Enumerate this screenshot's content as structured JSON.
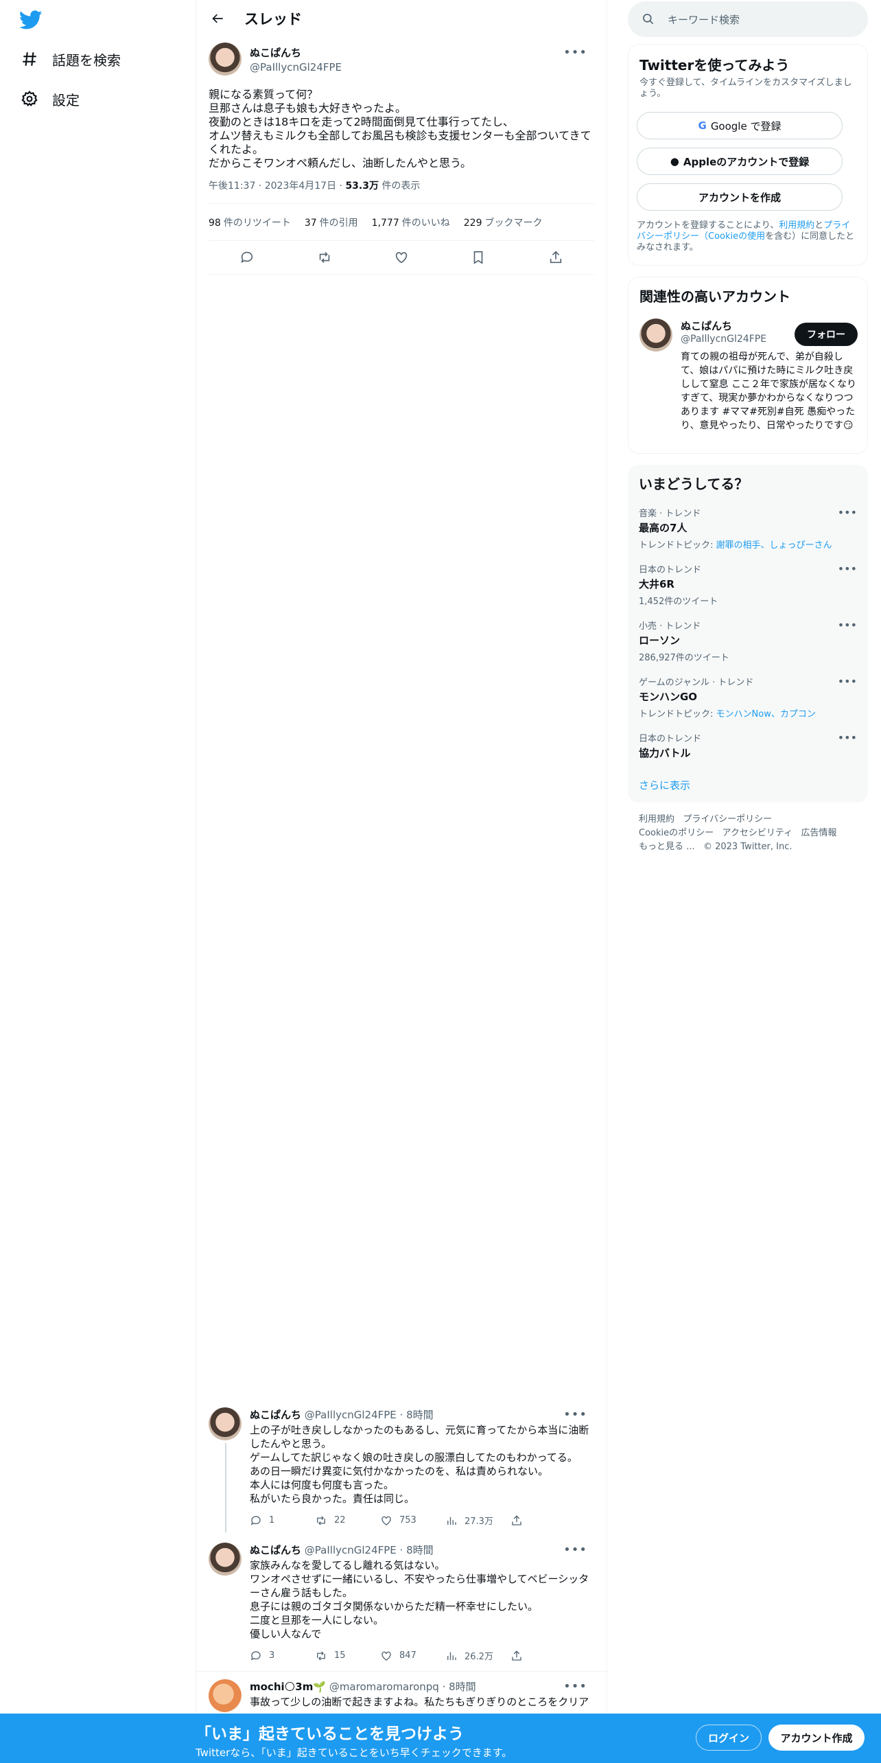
{
  "nav": {
    "explore_label": "話題を検索",
    "settings_label": "設定"
  },
  "header": {
    "title": "スレッド"
  },
  "main_tweet": {
    "display_name": "ぬこぱんち",
    "handle": "@PaIllycnGl24FPE",
    "text": "親になる素質って何？\n旦那さんは息子も娘も大好きやったよ。\n夜勤のときは18キロを走って2時間面倒見て仕事行ってたし、\nオムツ替えもミルクも全部してお風呂も検診も支援センターも全部ついてきてくれたよ。\nだからこそワンオペ頼んだし、油断したんやと思う。",
    "time": "午後11:37",
    "date": "2023年4月17日",
    "views_count": "53.3万",
    "views_label": "件の表示",
    "retweets_count": "98",
    "retweets_label": "件のリツイート",
    "quotes_count": "37",
    "quotes_label": "件の引用",
    "likes_count": "1,777",
    "likes_label": "件のいいね",
    "bookmarks_count": "229",
    "bookmarks_label": "ブックマーク"
  },
  "replies": [
    {
      "display_name": "ぬこぱんち",
      "handle": "@PaIllycnGl24FPE",
      "time": "8時間",
      "text": "上の子が吐き戻ししなかったのもあるし、元気に育ってたから本当に油断したんやと思う。\nゲームしてた訳じゃなく娘の吐き戻しの服漂白してたのもわかってる。\nあの日一瞬だけ異変に気付かなかったのを、私は責められない。\n本人には何度も何度も言った。\n私がいたら良かった。責任は同じ。",
      "replies": "1",
      "retweets": "22",
      "likes": "753",
      "views": "27.3万"
    },
    {
      "display_name": "ぬこぱんち",
      "handle": "@PaIllycnGl24FPE",
      "time": "8時間",
      "text": "家族みんなを愛してるし離れる気はない。\nワンオペさせずに一緒にいるし、不安やったら仕事増やしてベビーシッターさん雇う話もした。\n息子には親のゴタゴタ関係ないからただ精一杯幸せにしたい。\n二度と旦那を一人にしない。\n優しい人なんで",
      "replies": "3",
      "retweets": "15",
      "likes": "847",
      "views": "26.2万"
    },
    {
      "display_name": "mochi🌕3m🌱",
      "handle": "@maromaromaronpq",
      "time": "8時間",
      "text": "事故って少しの油断で起きますよね。私たちもぎりぎりのところをクリア"
    }
  ],
  "right": {
    "search_placeholder": "キーワード検索",
    "signup_card": {
      "title": "Twitterを使ってみよう",
      "subtitle": "今すぐ登録して、タイムラインをカスタマイズしましょう。",
      "google_btn": "Google で登録",
      "apple_btn": "Appleのアカウントで登録",
      "create_btn": "アカウントを作成",
      "legal_prefix": "アカウントを登録することにより、",
      "legal_terms": "利用規約",
      "legal_and": "と",
      "legal_privacy": "プライバシーポリシー（Cookieの使用",
      "legal_suffix": "を含む）に同意したとみなされます。"
    },
    "related": {
      "title": "関連性の高いアカウント",
      "name": "ぬこぱんち",
      "handle": "@PaIllycnGl24FPE",
      "follow_btn": "フォロー",
      "bio": "育ての親の祖母が死んで、弟が自殺して、娘はパパに預けた時にミルク吐き戻しして窒息 ここ２年で家族が居なくなりすぎて、現実か夢かわからなくなりつつあります #ママ#死別#自死 愚痴やったり、意見やったり、日常やったりです😏"
    },
    "trends": {
      "title": "いまどうしてる？",
      "items": [
        {
          "context": "音楽 · トレンド",
          "name": "最高の7人",
          "detail_prefix": "トレンドトピック: ",
          "detail_link": "謝罪の相手、しょっぴーさん"
        },
        {
          "context": "日本のトレンド",
          "name": "大井6R",
          "detail": "1,452件のツイート"
        },
        {
          "context": "小売 · トレンド",
          "name": "ローソン",
          "detail": "286,927件のツイート"
        },
        {
          "context": "ゲームのジャンル · トレンド",
          "name": "モンハンGO",
          "detail_prefix": "トレンドトピック: ",
          "detail_link": "モンハンNow、カプコン"
        },
        {
          "context": "日本のトレンド",
          "name": "協力バトル"
        }
      ],
      "show_more": "さらに表示"
    },
    "footer": {
      "terms": "利用規約",
      "privacy": "プライバシーポリシー",
      "cookie": "Cookieのポリシー",
      "accessibility": "アクセシビリティ",
      "ads": "広告情報",
      "more": "もっと見る ...",
      "copyright": "© 2023 Twitter, Inc."
    }
  },
  "bottom_bar": {
    "headline": "「いま」起きていることを見つけよう",
    "subline": "Twitterなら、「いま」起きていることをいち早くチェックできます。",
    "login_btn": "ログイン",
    "signup_btn": "アカウント作成"
  },
  "colors": {
    "brand": "#1d9bf0",
    "text": "#0f1419",
    "muted": "#536471"
  }
}
